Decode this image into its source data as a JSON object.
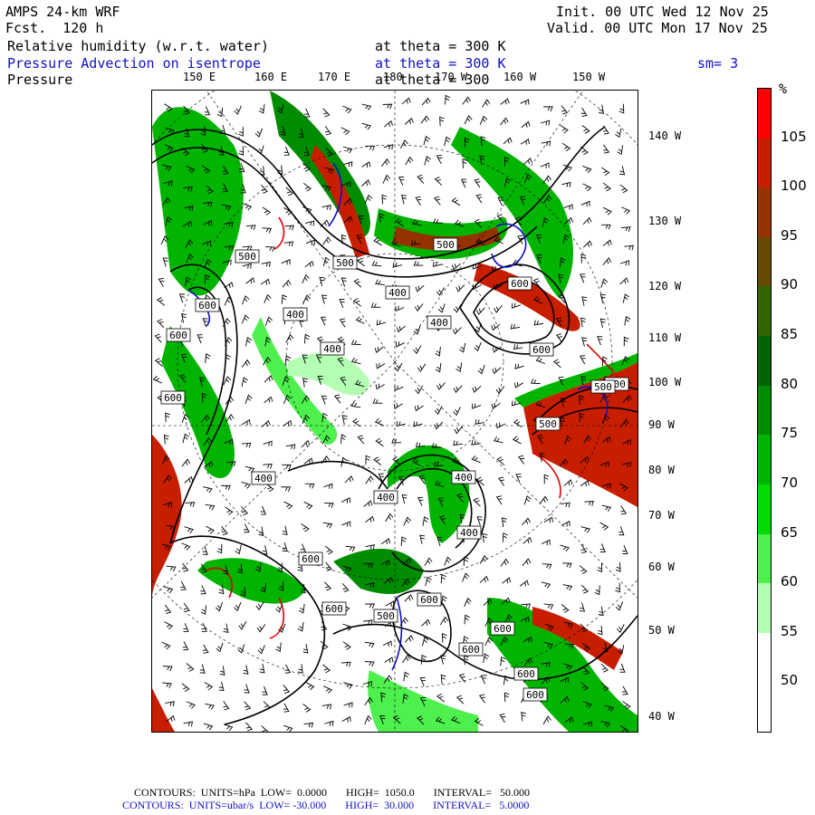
{
  "header": {
    "model": "AMPS 24-km WRF",
    "fcst": "Fcst.  120 h",
    "init": "Init. 00 UTC Wed 12 Nov 25",
    "valid": "Valid. 00 UTC Mon 17 Nov 25",
    "field1_name": "Relative humidity (w.r.t. water)",
    "field1_level": "at theta = 300 K",
    "field2_name": "Pressure Advection on isentrope",
    "field2_level": "at theta = 300 K",
    "field2_smooth": "sm= 3",
    "field3_name": "Pressure",
    "field3_level": "at theta = 300"
  },
  "lon_labels_top": [
    "150 E",
    "160 E",
    "170 E",
    "180",
    "170 W",
    "160 W",
    "150 W"
  ],
  "lat_labels_right": [
    "140 W",
    "130 W",
    "120 W",
    "110 W",
    "100 W",
    "90 W",
    "80 W",
    "70 W",
    "60 W",
    "50 W",
    "40 W"
  ],
  "colorbar": {
    "unit": "%",
    "ticks": [
      "105",
      "100",
      "95",
      "90",
      "85",
      "80",
      "75",
      "70",
      "65",
      "60",
      "55",
      "50"
    ],
    "colors": [
      "#ff0000",
      "#c81e00",
      "#963200",
      "#644b00",
      "#326400",
      "#006400",
      "#008c00",
      "#00b400",
      "#00dc00",
      "#4ef04e",
      "#b4ffb4",
      "#ffffff",
      "#ffffff"
    ]
  },
  "contour_labels": [
    {
      "text": "500"
    },
    {
      "text": "600"
    },
    {
      "text": "600"
    },
    {
      "text": "400"
    },
    {
      "text": "400"
    },
    {
      "text": "600"
    },
    {
      "text": "500"
    },
    {
      "text": "400"
    },
    {
      "text": "500"
    },
    {
      "text": "600"
    },
    {
      "text": "400"
    },
    {
      "text": "600"
    },
    {
      "text": "400"
    },
    {
      "text": "500"
    },
    {
      "text": "400"
    },
    {
      "text": "400"
    },
    {
      "text": "400"
    },
    {
      "text": "400"
    },
    {
      "text": "600"
    },
    {
      "text": "600"
    },
    {
      "text": "500"
    },
    {
      "text": "600"
    },
    {
      "text": "600"
    },
    {
      "text": "600"
    },
    {
      "text": "600"
    },
    {
      "text": "600"
    },
    {
      "text": "500"
    }
  ],
  "footer": {
    "line1": "CONTOURS:  UNITS=hPa  LOW=  0.0000       HIGH=  1050.0       INTERVAL=   50.000",
    "line2": "CONTOURS:  UNITS=ubar/s  LOW= -30.000       HIGH=  30.000       INTERVAL=   5.0000"
  }
}
